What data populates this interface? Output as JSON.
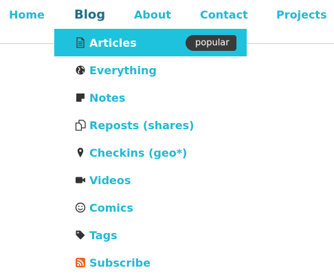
{
  "topnav": {
    "items": [
      {
        "label": "Home"
      },
      {
        "label": "Blog"
      },
      {
        "label": "About"
      },
      {
        "label": "Contact"
      },
      {
        "label": "Projects"
      }
    ],
    "active": "Blog"
  },
  "dropdown": {
    "items": [
      {
        "label": "Articles",
        "icon": "document-icon",
        "badge": "popular",
        "selected": true
      },
      {
        "label": "Everything",
        "icon": "globe-icon"
      },
      {
        "label": "Notes",
        "icon": "sticky-note-icon"
      },
      {
        "label": "Reposts (shares)",
        "icon": "copy-icon"
      },
      {
        "label": "Checkins (geo*)",
        "icon": "map-pin-icon"
      },
      {
        "label": "Videos",
        "icon": "video-camera-icon"
      },
      {
        "label": "Comics",
        "icon": "smiley-icon"
      },
      {
        "label": "Tags",
        "icon": "tag-icon"
      },
      {
        "label": "Subscribe",
        "icon": "rss-icon"
      }
    ]
  },
  "colors": {
    "accent": "#22b9d3",
    "active_nav": "#1c6f82",
    "selected_bg": "#1fc2dc",
    "badge_bg": "#3a3a3a",
    "icon_dark": "#333333",
    "rss_orange": "#f26522"
  }
}
